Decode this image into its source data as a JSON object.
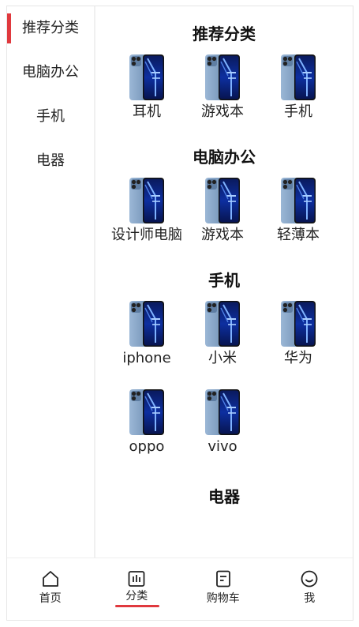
{
  "sidebar": {
    "items": [
      {
        "label": "推荐分类",
        "active": true
      },
      {
        "label": "电脑办公",
        "active": false
      },
      {
        "label": "手机",
        "active": false
      },
      {
        "label": "电器",
        "active": false
      }
    ]
  },
  "sections": [
    {
      "title": "推荐分类",
      "products": [
        "耳机",
        "游戏本",
        "手机"
      ]
    },
    {
      "title": "电脑办公",
      "products": [
        "设计师电脑",
        "游戏本",
        "轻薄本"
      ]
    },
    {
      "title": "手机",
      "products": [
        "iphone",
        "小米",
        "华为",
        "oppo",
        "vivo"
      ]
    },
    {
      "title": "电器",
      "products": []
    }
  ],
  "product_icon": "smartphone-product-image",
  "tabbar": {
    "tabs": [
      {
        "label": "首页",
        "icon": "home-icon"
      },
      {
        "label": "分类",
        "icon": "category-icon",
        "active": true
      },
      {
        "label": "购物车",
        "icon": "cart-icon"
      },
      {
        "label": "我",
        "icon": "profile-smile-icon"
      }
    ]
  },
  "colors": {
    "accent": "#e0393e",
    "border": "#e6e6e6",
    "text": "#222222"
  }
}
